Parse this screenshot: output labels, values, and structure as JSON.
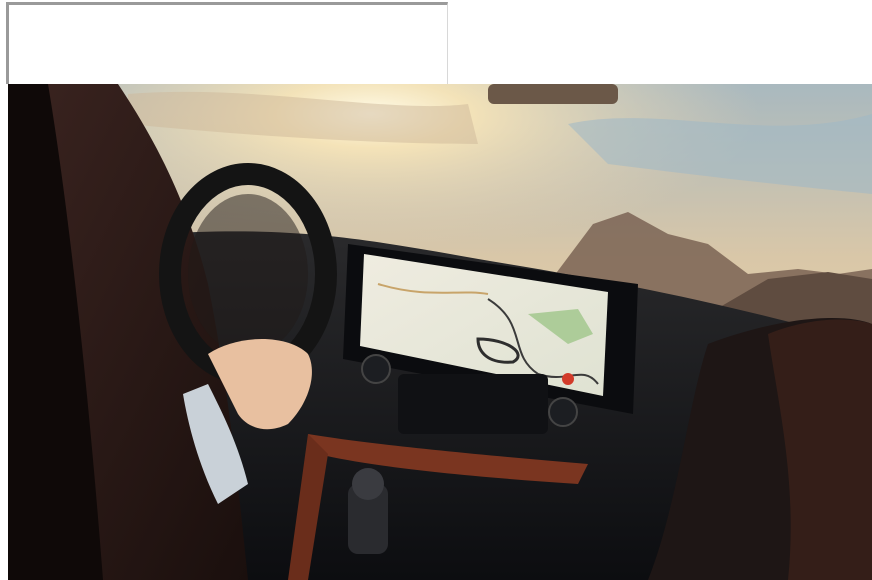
{
  "scene": {
    "description_icon": "car-interior-photo",
    "colors": {
      "sky_top": "#8fb3c7",
      "sun": "#fff6d8",
      "haze": "#e9d3b2",
      "mountain": "#6a5648",
      "dashboard": "#17191d",
      "screen_map": "#e9e6d8",
      "accent_trim": "#8a3b24"
    }
  }
}
